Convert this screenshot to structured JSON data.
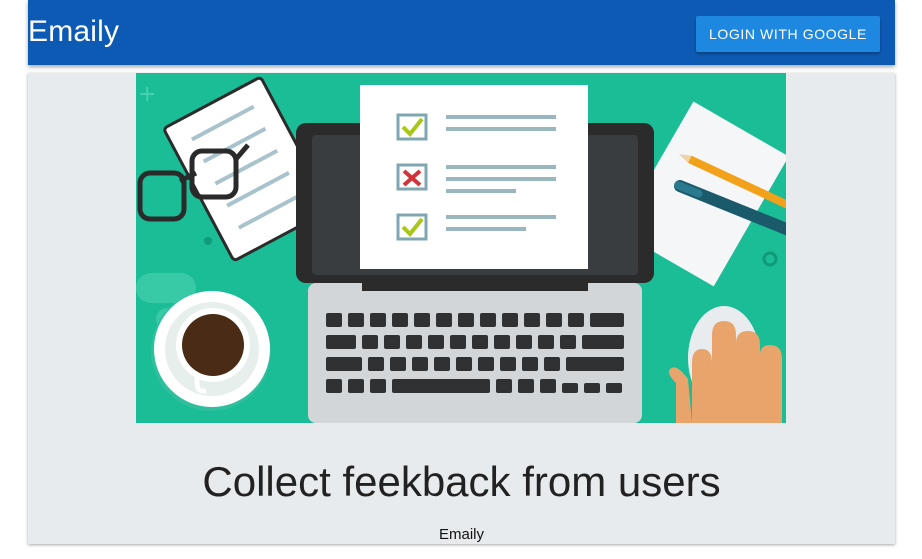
{
  "header": {
    "brand": "Emaily",
    "login_label": "LOGIN WITH GOOGLE"
  },
  "hero": {
    "image_icon": "survey-laptop-illustration",
    "background_color": "#1bbd96"
  },
  "main": {
    "headline": "Collect feekback from users",
    "footer_brand": "Emaily"
  },
  "colors": {
    "navbar": "#0d5ab4",
    "button": "#1e87e0",
    "card": "#e8ebee"
  }
}
